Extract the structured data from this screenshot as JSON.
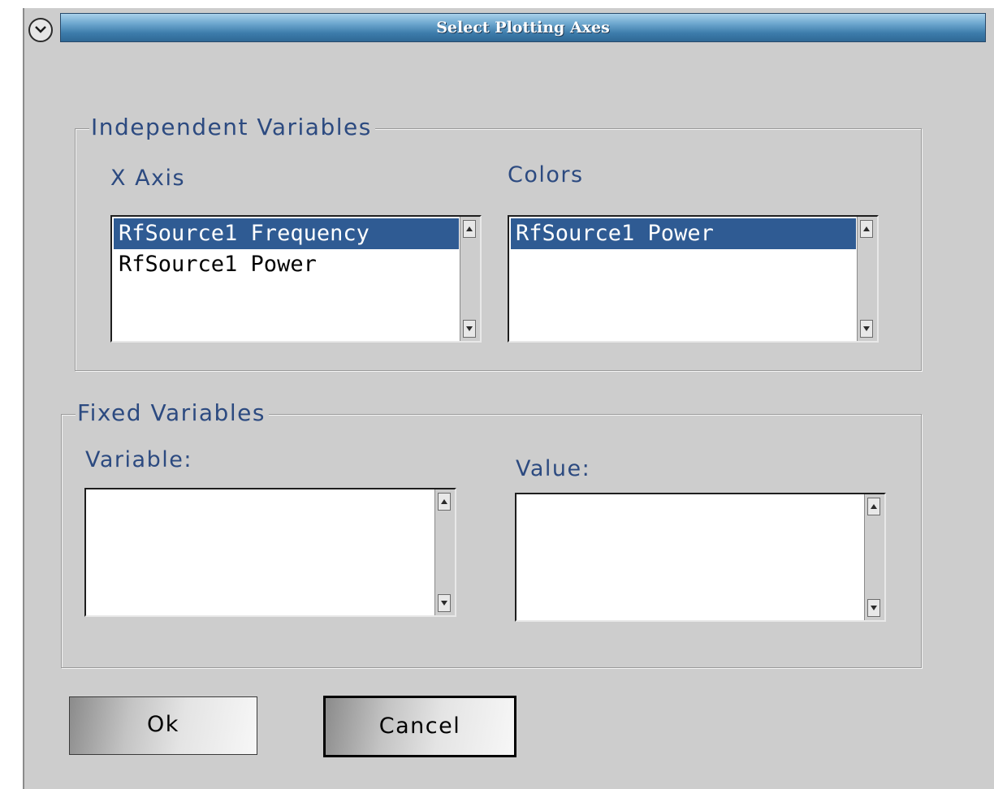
{
  "window": {
    "title": "Select Plotting Axes"
  },
  "independent": {
    "group_title": "Independent Variables",
    "x_axis": {
      "label": "X Axis",
      "items": [
        "RfSource1 Frequency",
        "RfSource1 Power"
      ],
      "selected": "RfSource1 Frequency"
    },
    "colors": {
      "label": "Colors",
      "items": [
        "RfSource1 Power"
      ],
      "selected": "RfSource1 Power"
    }
  },
  "fixed": {
    "group_title": "Fixed Variables",
    "variable_label": "Variable:",
    "value_label": "Value:"
  },
  "buttons": {
    "ok": "Ok",
    "cancel": "Cancel"
  },
  "colors": {
    "title_gradient_top": "#a9d0ea",
    "title_gradient_bottom": "#2f6895",
    "label_text": "#2c4a80",
    "selection": "#2f5b93",
    "window_bg": "#cdcdcd"
  }
}
